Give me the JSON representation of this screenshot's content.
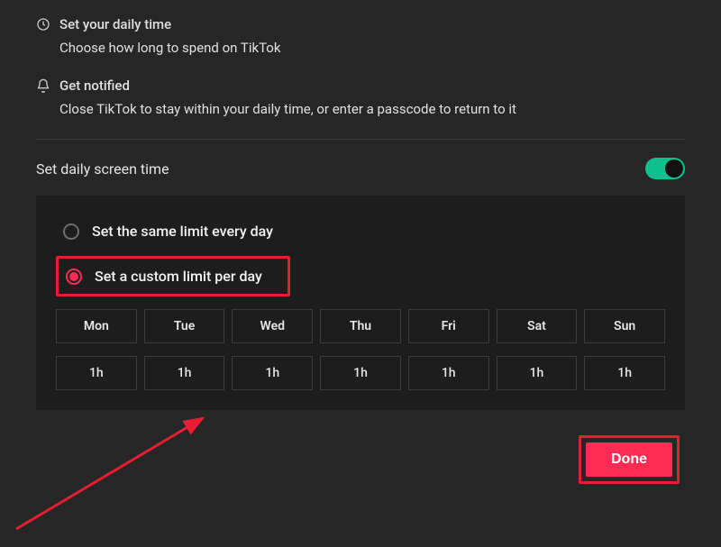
{
  "info": {
    "setTime": {
      "title": "Set your daily time",
      "desc": "Choose how long to spend on TikTok"
    },
    "notified": {
      "title": "Get notified",
      "desc": "Close TikTok to stay within your daily time, or enter a passcode to return to it"
    }
  },
  "toggle": {
    "label": "Set daily screen time",
    "on": true
  },
  "radio": {
    "same": "Set the same limit every day",
    "custom": "Set a custom limit per day",
    "selected": "custom"
  },
  "days": [
    "Mon",
    "Tue",
    "Wed",
    "Thu",
    "Fri",
    "Sat",
    "Sun"
  ],
  "values": [
    "1h",
    "1h",
    "1h",
    "1h",
    "1h",
    "1h",
    "1h"
  ],
  "footer": {
    "done": "Done"
  },
  "colors": {
    "accent": "#fe2c55",
    "toggle": "#0dc18f",
    "highlight": "#e51e31"
  }
}
